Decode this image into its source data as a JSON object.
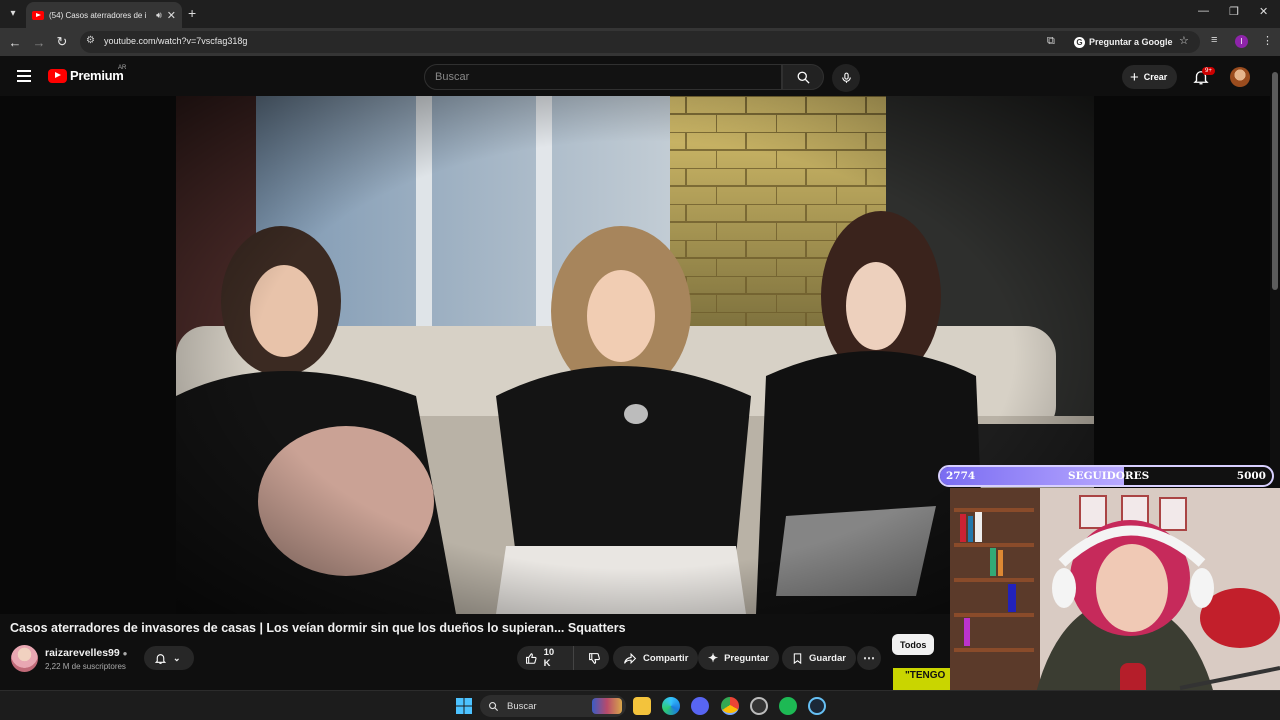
{
  "browser": {
    "tab_title": "(54) Casos aterradores de i",
    "url": "youtube.com/watch?v=7vscfag318g",
    "ask_google_label": "Preguntar a Google",
    "profile_letter": "I"
  },
  "youtube": {
    "logo_text": "Premium",
    "country_code": "AR",
    "search_placeholder": "Buscar",
    "create_label": "Crear",
    "notifications_badge": "9+"
  },
  "video": {
    "title": "Casos aterradores de invasores de casas | Los veían dormir sin que los dueños lo supieran... Squatters",
    "channel_name": "raizarevelles99",
    "subscribers": "2,22 M de suscriptores",
    "likes": "10 K",
    "share_label": "Compartir",
    "ask_label": "Preguntar",
    "save_label": "Guardar"
  },
  "sidebar": {
    "chip_all": "Todos",
    "next_thumb_text": "\"TENGO"
  },
  "overlay": {
    "followers_current": "2774",
    "followers_label": "SEGUIDORES",
    "followers_goal": "5000",
    "followers_progress": 0.555
  },
  "taskbar": {
    "search_label": "Buscar"
  },
  "colors": {
    "youtube_red": "#ff0000",
    "bar_purple": "#7a6cf2"
  }
}
